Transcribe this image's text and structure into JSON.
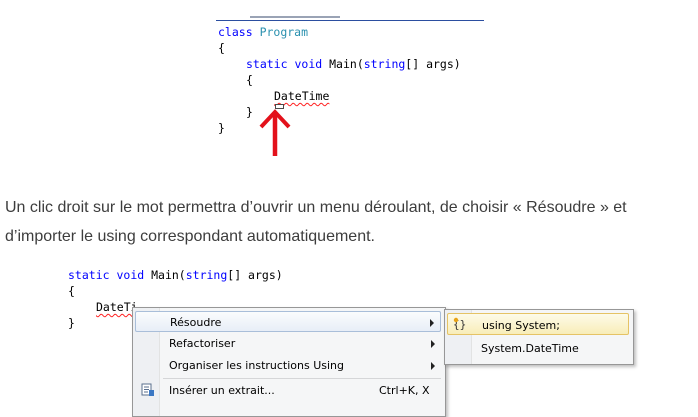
{
  "top_code": {
    "lines": [
      "class",
      "Program",
      "{",
      "static",
      "void",
      "Main(",
      "string",
      "[] args)",
      "{",
      "DateTime",
      "}",
      "}"
    ]
  },
  "paragraph": "Un clic droit sur le mot permettra d’ouvrir un menu déroulant, de choisir « Résoudre » et d’importer le using correspondant automatiquement.",
  "bottom_code": {
    "kw_static": "static",
    "kw_void": "void",
    "main": " Main(",
    "kw_string": "string",
    "args": "[] args)",
    "brace_open": "{",
    "datetime_partial": "DateTi",
    "brace_close": "}"
  },
  "context_menu": {
    "items": [
      {
        "label": "Résoudre",
        "has_submenu": true
      },
      {
        "label": "Refactoriser",
        "has_submenu": true
      },
      {
        "label": "Organiser les instructions Using",
        "has_submenu": true
      },
      {
        "label": "Insérer un extrait...",
        "shortcut": "Ctrl+K, X",
        "icon": "snippet-icon"
      }
    ]
  },
  "submenu": {
    "items": [
      {
        "label": "using System;",
        "icon": "using-namespace-icon"
      },
      {
        "label": "System.DateTime"
      }
    ]
  },
  "colors": {
    "keyword": "#0000ff",
    "type": "#2b91af",
    "error_squiggle": "#ff2020",
    "arrow": "#e3111b",
    "paragraph_text": "#3d3d3d"
  }
}
